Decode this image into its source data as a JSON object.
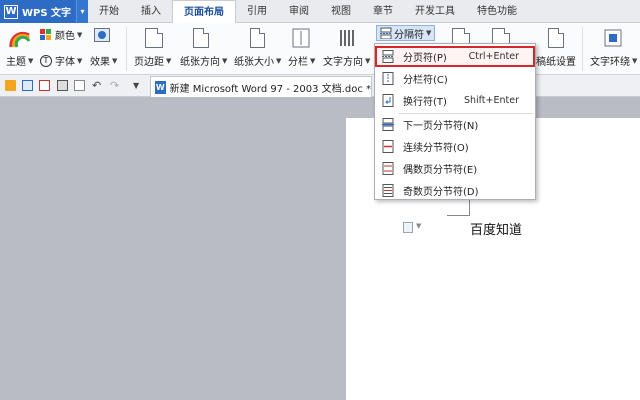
{
  "app": {
    "logo": "W",
    "name": "WPS 文字",
    "menu_arrow": "▾"
  },
  "tabs": [
    {
      "label": "开始"
    },
    {
      "label": "插入"
    },
    {
      "label": "页面布局",
      "active": true
    },
    {
      "label": "引用"
    },
    {
      "label": "审阅"
    },
    {
      "label": "视图"
    },
    {
      "label": "章节"
    },
    {
      "label": "开发工具"
    },
    {
      "label": "特色功能"
    }
  ],
  "ribbon": {
    "color_label": "颜色",
    "theme_label": "主题",
    "font_label": "字体",
    "effect_label": "效果",
    "margin_label": "页边距",
    "orientation_label": "纸张方向",
    "size_label": "纸张大小",
    "columns_label": "分栏",
    "text_direction_label": "文字方向",
    "separator_label": "分隔符",
    "paper_setting_label": "稿纸设置",
    "text_wrap_label": "文字环绕"
  },
  "quick": {
    "doc_title": "新建 Microsoft Word 97 - 2003 文档.doc *"
  },
  "menu": {
    "items": [
      {
        "label": "分页符(P)",
        "shortcut": "Ctrl+Enter"
      },
      {
        "label": "分栏符(C)",
        "shortcut": ""
      },
      {
        "label": "换行符(T)",
        "shortcut": "Shift+Enter"
      },
      {
        "label": "下一页分节符(N)",
        "shortcut": ""
      },
      {
        "label": "连续分节符(O)",
        "shortcut": ""
      },
      {
        "label": "偶数页分节符(E)",
        "shortcut": ""
      },
      {
        "label": "奇数页分节符(D)",
        "shortcut": ""
      }
    ]
  },
  "document": {
    "text": "百度知道"
  },
  "colors": {
    "accent": "#2d6bc4",
    "highlight": "#d8262b"
  }
}
